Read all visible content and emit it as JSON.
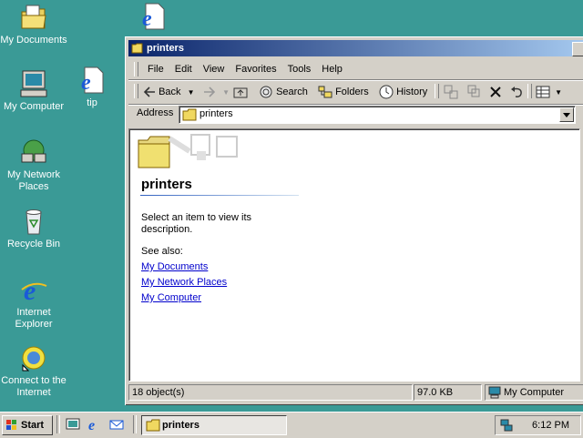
{
  "desktop": {
    "icons": [
      {
        "label": "My Documents"
      },
      {
        "label": "My Computer"
      },
      {
        "label": "My Network Places"
      },
      {
        "label": "Recycle Bin"
      },
      {
        "label": "Internet Explorer"
      },
      {
        "label": "Connect to the Internet"
      },
      {
        "label": "tip"
      }
    ]
  },
  "window": {
    "title": "printers",
    "menu": [
      "File",
      "Edit",
      "View",
      "Favorites",
      "Tools",
      "Help"
    ],
    "toolbar": {
      "back": "Back",
      "search": "Search",
      "folders": "Folders",
      "history": "History"
    },
    "address": {
      "label": "Address",
      "value": "printers"
    },
    "content": {
      "heading": "printers",
      "description": "Select an item to view its description.",
      "see_also": "See also:",
      "links": [
        "My Documents",
        "My Network Places",
        "My Computer"
      ]
    },
    "status": {
      "objects": "18 object(s)",
      "size": "97.0 KB",
      "zone": "My Computer"
    }
  },
  "taskbar": {
    "start": "Start",
    "task": "printers",
    "clock": "6:12 PM"
  },
  "colors": {
    "desktop": "#3a9a96",
    "title_start": "#0a246a",
    "title_end": "#a6caf0",
    "link": "#0000cc"
  }
}
